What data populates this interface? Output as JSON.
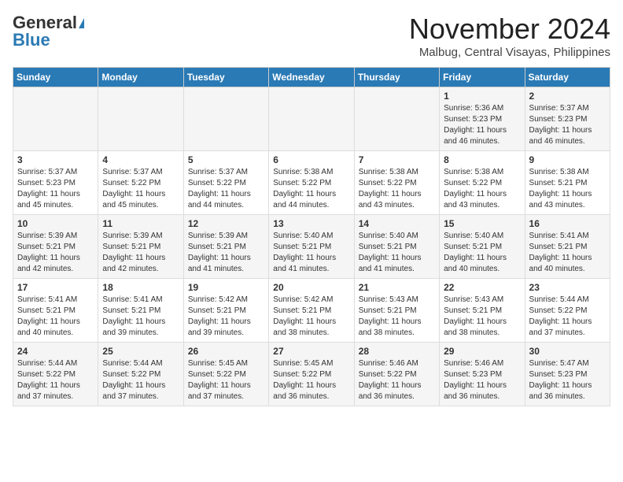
{
  "header": {
    "logo_line1": "General",
    "logo_line2": "Blue",
    "month": "November 2024",
    "location": "Malbug, Central Visayas, Philippines"
  },
  "days_of_week": [
    "Sunday",
    "Monday",
    "Tuesday",
    "Wednesday",
    "Thursday",
    "Friday",
    "Saturday"
  ],
  "weeks": [
    [
      {
        "day": "",
        "info": ""
      },
      {
        "day": "",
        "info": ""
      },
      {
        "day": "",
        "info": ""
      },
      {
        "day": "",
        "info": ""
      },
      {
        "day": "",
        "info": ""
      },
      {
        "day": "1",
        "info": "Sunrise: 5:36 AM\nSunset: 5:23 PM\nDaylight: 11 hours and 46 minutes."
      },
      {
        "day": "2",
        "info": "Sunrise: 5:37 AM\nSunset: 5:23 PM\nDaylight: 11 hours and 46 minutes."
      }
    ],
    [
      {
        "day": "3",
        "info": "Sunrise: 5:37 AM\nSunset: 5:23 PM\nDaylight: 11 hours and 45 minutes."
      },
      {
        "day": "4",
        "info": "Sunrise: 5:37 AM\nSunset: 5:22 PM\nDaylight: 11 hours and 45 minutes."
      },
      {
        "day": "5",
        "info": "Sunrise: 5:37 AM\nSunset: 5:22 PM\nDaylight: 11 hours and 44 minutes."
      },
      {
        "day": "6",
        "info": "Sunrise: 5:38 AM\nSunset: 5:22 PM\nDaylight: 11 hours and 44 minutes."
      },
      {
        "day": "7",
        "info": "Sunrise: 5:38 AM\nSunset: 5:22 PM\nDaylight: 11 hours and 43 minutes."
      },
      {
        "day": "8",
        "info": "Sunrise: 5:38 AM\nSunset: 5:22 PM\nDaylight: 11 hours and 43 minutes."
      },
      {
        "day": "9",
        "info": "Sunrise: 5:38 AM\nSunset: 5:21 PM\nDaylight: 11 hours and 43 minutes."
      }
    ],
    [
      {
        "day": "10",
        "info": "Sunrise: 5:39 AM\nSunset: 5:21 PM\nDaylight: 11 hours and 42 minutes."
      },
      {
        "day": "11",
        "info": "Sunrise: 5:39 AM\nSunset: 5:21 PM\nDaylight: 11 hours and 42 minutes."
      },
      {
        "day": "12",
        "info": "Sunrise: 5:39 AM\nSunset: 5:21 PM\nDaylight: 11 hours and 41 minutes."
      },
      {
        "day": "13",
        "info": "Sunrise: 5:40 AM\nSunset: 5:21 PM\nDaylight: 11 hours and 41 minutes."
      },
      {
        "day": "14",
        "info": "Sunrise: 5:40 AM\nSunset: 5:21 PM\nDaylight: 11 hours and 41 minutes."
      },
      {
        "day": "15",
        "info": "Sunrise: 5:40 AM\nSunset: 5:21 PM\nDaylight: 11 hours and 40 minutes."
      },
      {
        "day": "16",
        "info": "Sunrise: 5:41 AM\nSunset: 5:21 PM\nDaylight: 11 hours and 40 minutes."
      }
    ],
    [
      {
        "day": "17",
        "info": "Sunrise: 5:41 AM\nSunset: 5:21 PM\nDaylight: 11 hours and 40 minutes."
      },
      {
        "day": "18",
        "info": "Sunrise: 5:41 AM\nSunset: 5:21 PM\nDaylight: 11 hours and 39 minutes."
      },
      {
        "day": "19",
        "info": "Sunrise: 5:42 AM\nSunset: 5:21 PM\nDaylight: 11 hours and 39 minutes."
      },
      {
        "day": "20",
        "info": "Sunrise: 5:42 AM\nSunset: 5:21 PM\nDaylight: 11 hours and 38 minutes."
      },
      {
        "day": "21",
        "info": "Sunrise: 5:43 AM\nSunset: 5:21 PM\nDaylight: 11 hours and 38 minutes."
      },
      {
        "day": "22",
        "info": "Sunrise: 5:43 AM\nSunset: 5:21 PM\nDaylight: 11 hours and 38 minutes."
      },
      {
        "day": "23",
        "info": "Sunrise: 5:44 AM\nSunset: 5:22 PM\nDaylight: 11 hours and 37 minutes."
      }
    ],
    [
      {
        "day": "24",
        "info": "Sunrise: 5:44 AM\nSunset: 5:22 PM\nDaylight: 11 hours and 37 minutes."
      },
      {
        "day": "25",
        "info": "Sunrise: 5:44 AM\nSunset: 5:22 PM\nDaylight: 11 hours and 37 minutes."
      },
      {
        "day": "26",
        "info": "Sunrise: 5:45 AM\nSunset: 5:22 PM\nDaylight: 11 hours and 37 minutes."
      },
      {
        "day": "27",
        "info": "Sunrise: 5:45 AM\nSunset: 5:22 PM\nDaylight: 11 hours and 36 minutes."
      },
      {
        "day": "28",
        "info": "Sunrise: 5:46 AM\nSunset: 5:22 PM\nDaylight: 11 hours and 36 minutes."
      },
      {
        "day": "29",
        "info": "Sunrise: 5:46 AM\nSunset: 5:23 PM\nDaylight: 11 hours and 36 minutes."
      },
      {
        "day": "30",
        "info": "Sunrise: 5:47 AM\nSunset: 5:23 PM\nDaylight: 11 hours and 36 minutes."
      }
    ]
  ]
}
